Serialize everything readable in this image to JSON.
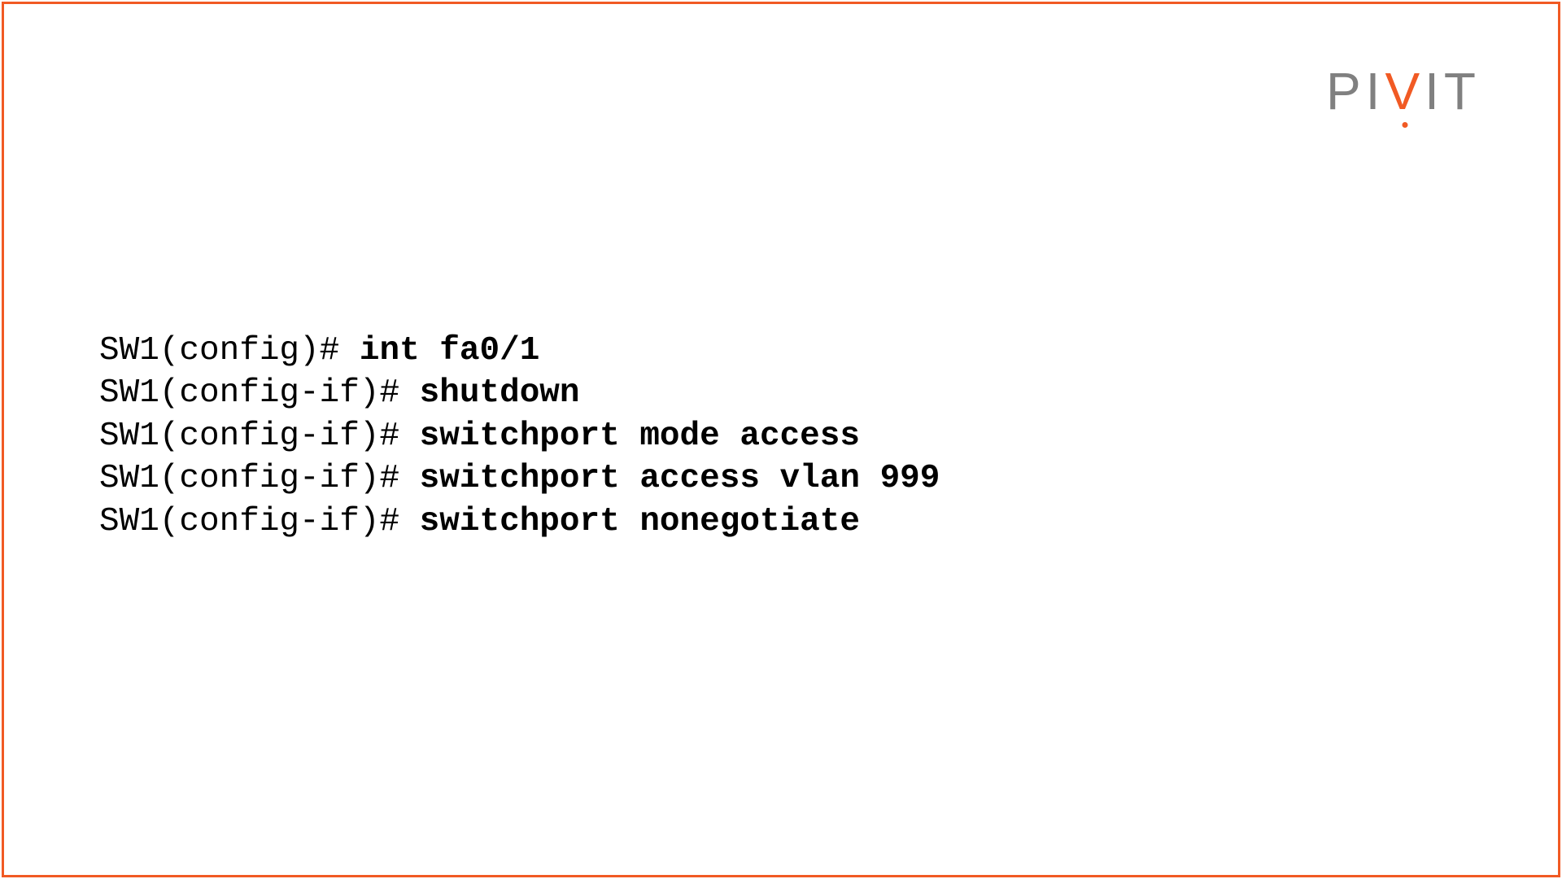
{
  "logo": {
    "part1": "PI",
    "part2": "V",
    "part3": "IT"
  },
  "terminal": {
    "lines": [
      {
        "prompt": "SW1(config)# ",
        "command": "int fa0/1"
      },
      {
        "prompt": "SW1(config-if)# ",
        "command": "shutdown"
      },
      {
        "prompt": "SW1(config-if)# ",
        "command": "switchport mode access"
      },
      {
        "prompt": "SW1(config-if)# ",
        "command": "switchport access vlan 999"
      },
      {
        "prompt": "SW1(config-if)# ",
        "command": "switchport nonegotiate"
      }
    ]
  },
  "colors": {
    "accent": "#f15a24",
    "gray": "#808080"
  }
}
